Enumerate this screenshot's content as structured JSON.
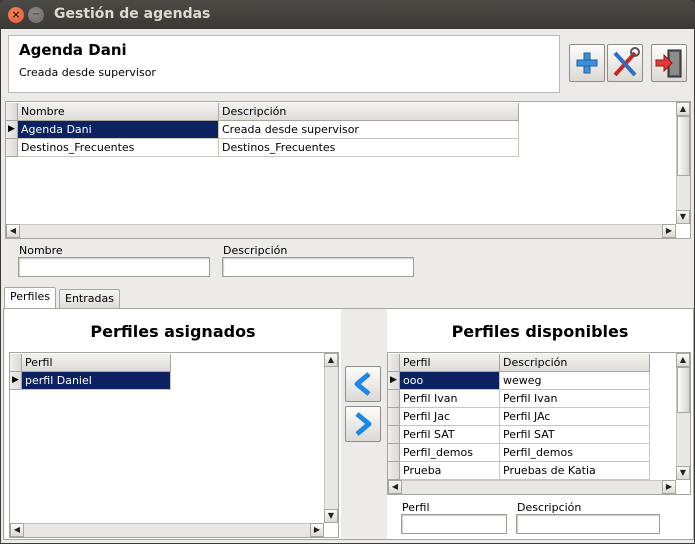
{
  "window": {
    "title": "Gestión de agendas",
    "close_glyph": "×",
    "min_glyph": "−"
  },
  "header": {
    "title": "Agenda Dani",
    "subtitle": "Creada desde supervisor"
  },
  "toolbar": {
    "add_icon": "plus-icon",
    "tools_icon": "wrench-screwdriver-icon",
    "exit_icon": "exit-door-icon"
  },
  "agendas_table": {
    "columns": [
      "Nombre",
      "Descripción"
    ],
    "rows": [
      {
        "nombre": "Agenda Dani",
        "descripcion": "Creada desde supervisor"
      },
      {
        "nombre": "Destinos_Frecuentes",
        "descripcion": "Destinos_Frecuentes"
      }
    ]
  },
  "filters": {
    "nombre_label": "Nombre",
    "descripcion_label": "Descripción",
    "nombre_value": "",
    "descripcion_value": ""
  },
  "tabs": [
    "Perfiles",
    "Entradas"
  ],
  "assigned": {
    "title": "Perfiles asignados",
    "columns": [
      "Perfil"
    ],
    "rows": [
      "perfil Daniel"
    ]
  },
  "available": {
    "title": "Perfiles disponibles",
    "columns": [
      "Perfil",
      "Descripción"
    ],
    "rows": [
      {
        "perfil": "ooo",
        "descripcion": "weweg"
      },
      {
        "perfil": "Perfil Ivan",
        "descripcion": "Perfil Ivan"
      },
      {
        "perfil": "Perfil Jac",
        "descripcion": "Perfil JAc"
      },
      {
        "perfil": "Perfil SAT",
        "descripcion": "Perfil SAT"
      },
      {
        "perfil": "Perfil_demos",
        "descripcion": "Perfil_demos"
      },
      {
        "perfil": "Prueba",
        "descripcion": "Pruebas de Katia"
      }
    ],
    "perfil_label": "Perfil",
    "descripcion_label": "Descripción"
  },
  "transfer": {
    "left_icon": "chevron-left-icon",
    "right_icon": "chevron-right-icon"
  },
  "colors": {
    "selection": "#0c2261",
    "titlebar": "#3c3b37",
    "arrow": "#1e88e5"
  }
}
